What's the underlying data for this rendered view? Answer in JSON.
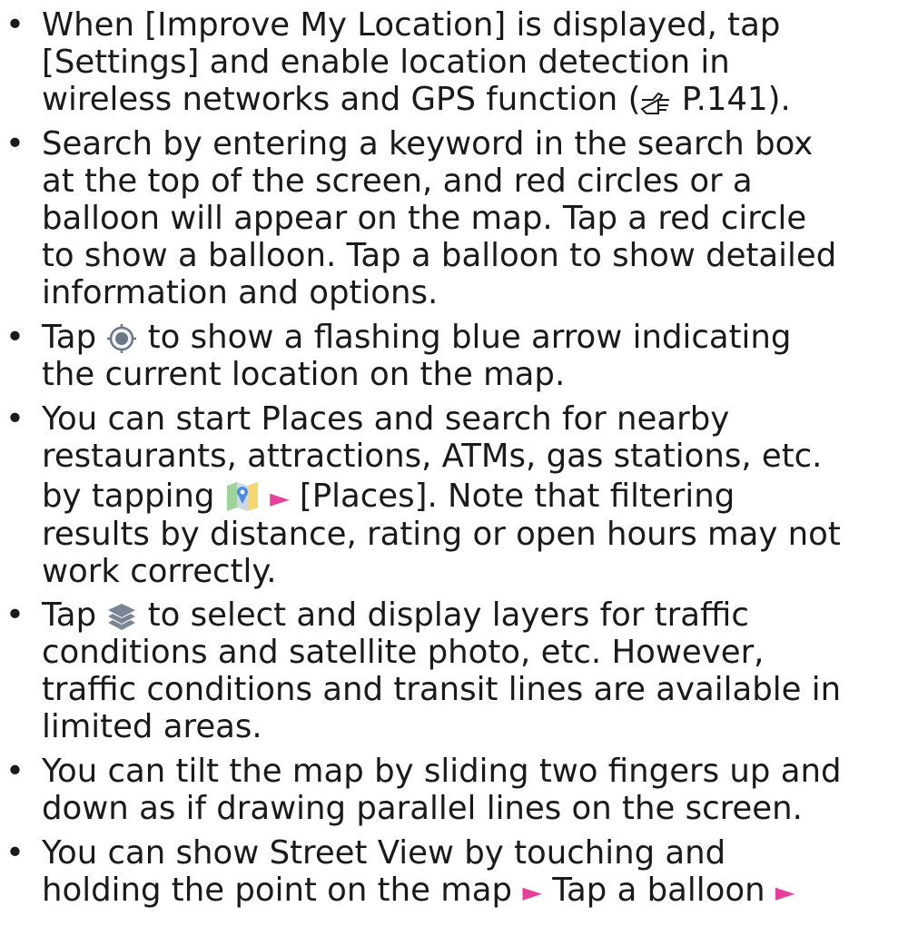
{
  "lines": {
    "l0a": "When [Improve My Location] is displayed, tap",
    "l0b": "[Settings] and enable location detection in",
    "l0c": "wireless networks and GPS function (",
    "l0d": " P.141).",
    "l1a": "Search by entering a keyword in the search box",
    "l1b": "at the top of the screen, and red circles or a",
    "l1c": "balloon will appear on the map. Tap a red circle",
    "l1d": "to show a balloon. Tap a balloon to show detailed",
    "l1e": "information and options.",
    "l2a": "Tap",
    "l2b": "to show a flashing blue arrow indicating",
    "l2c": "the current location on the map.",
    "l3a": "You can start Places and search for nearby",
    "l3b": "restaurants, attractions, ATMs, gas stations, etc.",
    "l3c": "by tapping",
    "l3d": "[Places]. Note that filtering",
    "l3e": "results by distance, rating or open hours may not",
    "l3f": "work correctly.",
    "l4a": "Tap",
    "l4b": "to select and display layers for traffic",
    "l4c": "conditions and satellite photo, etc. However,",
    "l4d": "traffic conditions and transit lines are available in",
    "l4e": "limited areas.",
    "l5a": "You can tilt the map by sliding two fingers up and",
    "l5b": "down as if drawing parallel lines on the screen.",
    "l6a": "You can show Street View by touching and",
    "l6b": "holding the point on the map",
    "l6c": "Tap a balloon"
  },
  "glyphs": {
    "bullet": "•",
    "arrow": "►"
  },
  "icons": {
    "reference": "pointing-hand-icon",
    "my_location": "my-location-icon",
    "maps_app": "maps-app-icon",
    "layers": "layers-icon"
  },
  "colors": {
    "arrow": "#e8409a",
    "text": "#1a1a1a",
    "my_location": "#6b7785",
    "layers": "#7a8594"
  }
}
